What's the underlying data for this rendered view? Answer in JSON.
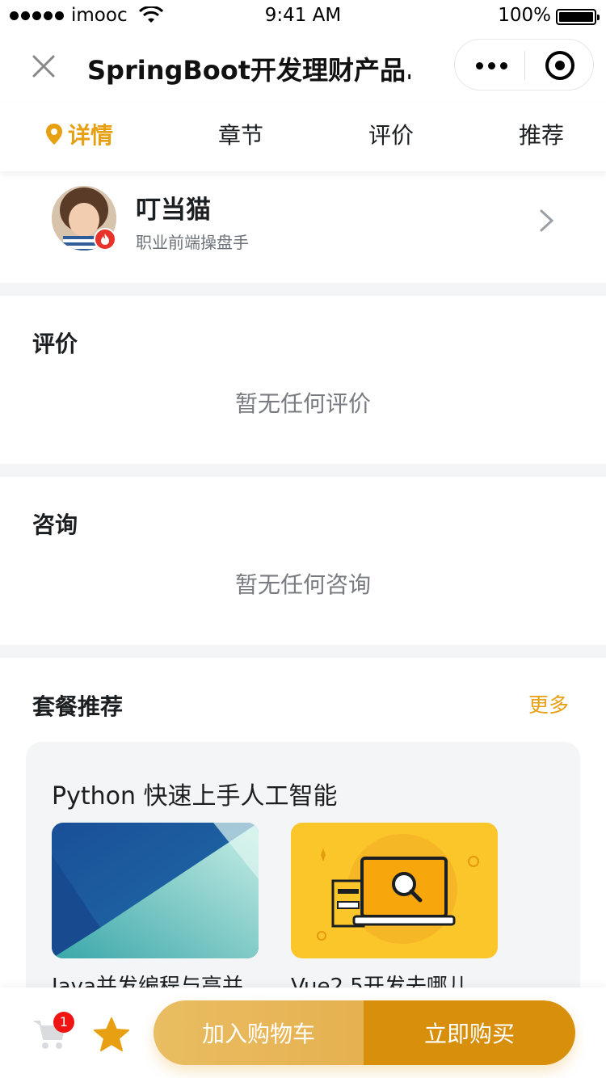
{
  "status_bar": {
    "carrier": "imooc",
    "time": "9:41 AM",
    "battery": "100%"
  },
  "nav": {
    "title": "SpringBoot开发理财产品..."
  },
  "tabs": [
    {
      "label": "详情",
      "active": true
    },
    {
      "label": "章节"
    },
    {
      "label": "评价"
    },
    {
      "label": "推荐"
    }
  ],
  "teacher": {
    "name": "叮当猫",
    "title": "职业前端操盘手"
  },
  "reviews": {
    "title": "评价",
    "empty": "暂无任何评价"
  },
  "consult": {
    "title": "咨询",
    "empty": "暂无任何咨询"
  },
  "package": {
    "title": "套餐推荐",
    "more": "更多",
    "card_title": "Python 快速上手人工智能",
    "courses": [
      {
        "name": "Java并发编程与高并"
      },
      {
        "name": "Vue2.5开发去哪儿"
      }
    ]
  },
  "bottom": {
    "cart_count": "1",
    "add_cart": "加入购物车",
    "buy_now": "立即购买"
  },
  "colors": {
    "accent": "#e8a013",
    "buy_button": "#d88f0b",
    "add_cart_button": "#e6b150",
    "badge": "#f01414"
  }
}
